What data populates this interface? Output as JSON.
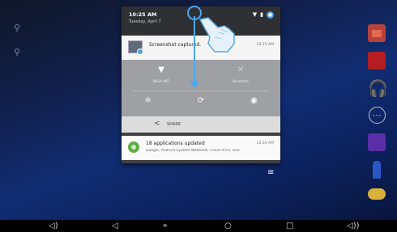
{
  "status": {
    "time": "10:25 AM",
    "date": "Tuesday, April 7"
  },
  "notifications": [
    {
      "title": "Screenshot captured.",
      "time": "10:25 AM"
    },
    {
      "title": "18 applications updated",
      "subtitle": "Google, Android System WebView, Cloud Print, Goo",
      "time": "10:24 AM"
    }
  ],
  "quick_settings": {
    "wifi_label": "NASA MKT",
    "bluetooth_label": "Bluetooth",
    "share_label": "SHARE"
  },
  "colors": {
    "accent": "#4aa7ef",
    "wallpaper": "#1f52d0",
    "shade_header": "#2f3033",
    "quick_settings_bg": "#9ea0a3"
  },
  "icons": {
    "wifi": "wifi-icon",
    "bluetooth": "bluetooth-icon",
    "brightness": "brightness-icon",
    "rotate": "rotate-icon",
    "location": "location-icon",
    "share": "share-icon",
    "clear_all": "clear-all-icon"
  }
}
